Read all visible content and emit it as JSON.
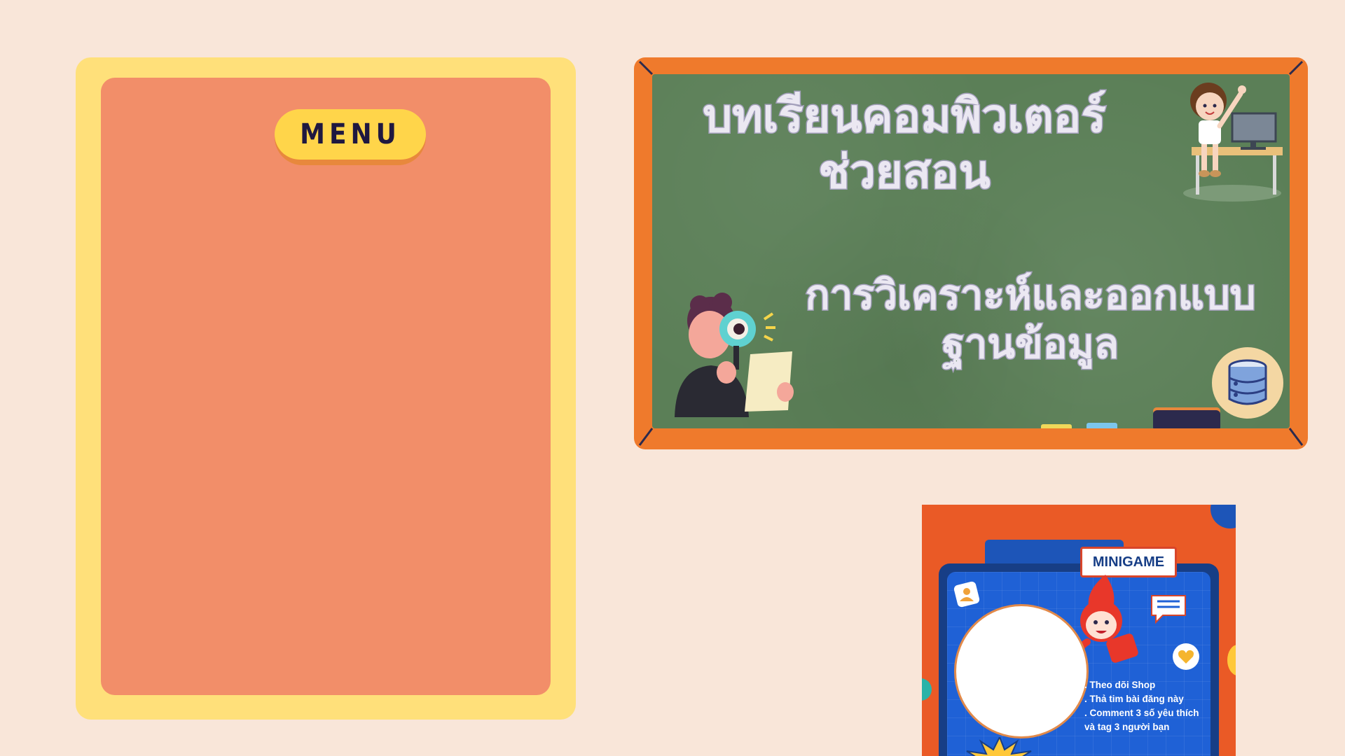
{
  "menu": {
    "title": "MENU"
  },
  "board": {
    "title": "บทเรียนคอมพิวเตอร์ช่วยสอน",
    "subtitle": "การวิเคราะห์และออกแบบฐานข้อมูล"
  },
  "minigame": {
    "label": "MINIGAME",
    "rules": [
      ". Theo dõi Shop",
      ". Thả tim bài đăng này",
      ". Comment 3 số yêu thích",
      "và tag 3 người bạn"
    ]
  },
  "colors": {
    "background": "#f9e6d9",
    "menu_frame": "#ffe07a",
    "menu_panel": "#f28e69",
    "menu_button": "#ffd54a",
    "board_frame": "#ef7a2c",
    "board_green": "#5b7f57",
    "minigame_orange": "#ea5a26",
    "minigame_blue": "#1f61d6"
  },
  "icons": [
    "student-at-computer-icon",
    "magnifier-person-icon",
    "database-icon",
    "mascot-icon",
    "chat-icon",
    "heart-icon",
    "photo-icon"
  ]
}
